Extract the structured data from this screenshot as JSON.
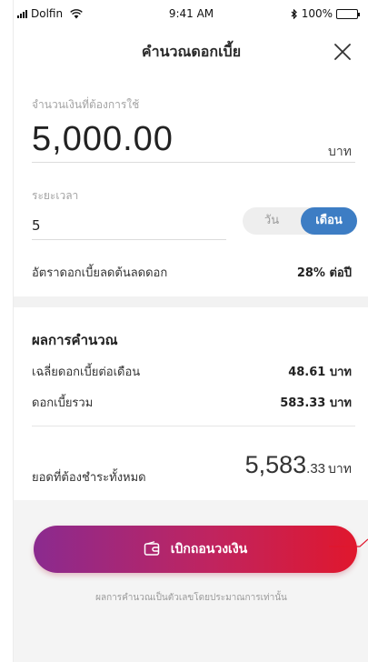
{
  "status_bar": {
    "carrier": "Dolfin",
    "time": "9:41 AM",
    "battery": "100%"
  },
  "header": {
    "title": "คำนวณดอกเบี้ย"
  },
  "amount": {
    "label": "จำนวนเงินที่ต้องการใช้",
    "value": "5,000.00",
    "unit": "บาท"
  },
  "period": {
    "label": "ระยะเวลา",
    "value": "5",
    "options": [
      "วัน",
      "เดือน"
    ],
    "selected": "เดือน"
  },
  "rate": {
    "label": "อัตราดอกเบี้ยลดต้นลดดอก",
    "value": "28% ต่อปี"
  },
  "results": {
    "title": "ผลการคำนวณ",
    "rows": [
      {
        "label": "เฉลี่ยดอกเบี้ยต่อเดือน",
        "value": "48.61 บาท"
      },
      {
        "label": "ดอกเบี้ยรวม",
        "value": "583.33 บาท"
      }
    ],
    "total_label": "ยอดที่ต้องชำระทั้งหมด",
    "total_main": "5,583",
    "total_decimal": ".33",
    "total_unit": "บาท"
  },
  "cta": {
    "label": "เบิกถอนวงเงิน"
  },
  "disclaimer": "ผลการคำนวณเป็นตัวเลขโดยประมาณการเท่านั้น",
  "colors": {
    "accent_blue": "#3d7dc4",
    "cta_start": "#8b2a8f",
    "cta_end": "#e0172d"
  },
  "icons": {
    "close": "close-icon",
    "wallet": "wallet-icon",
    "wifi": "wifi-icon",
    "bluetooth": "bluetooth-icon",
    "battery": "battery-icon",
    "signal": "signal-icon"
  }
}
